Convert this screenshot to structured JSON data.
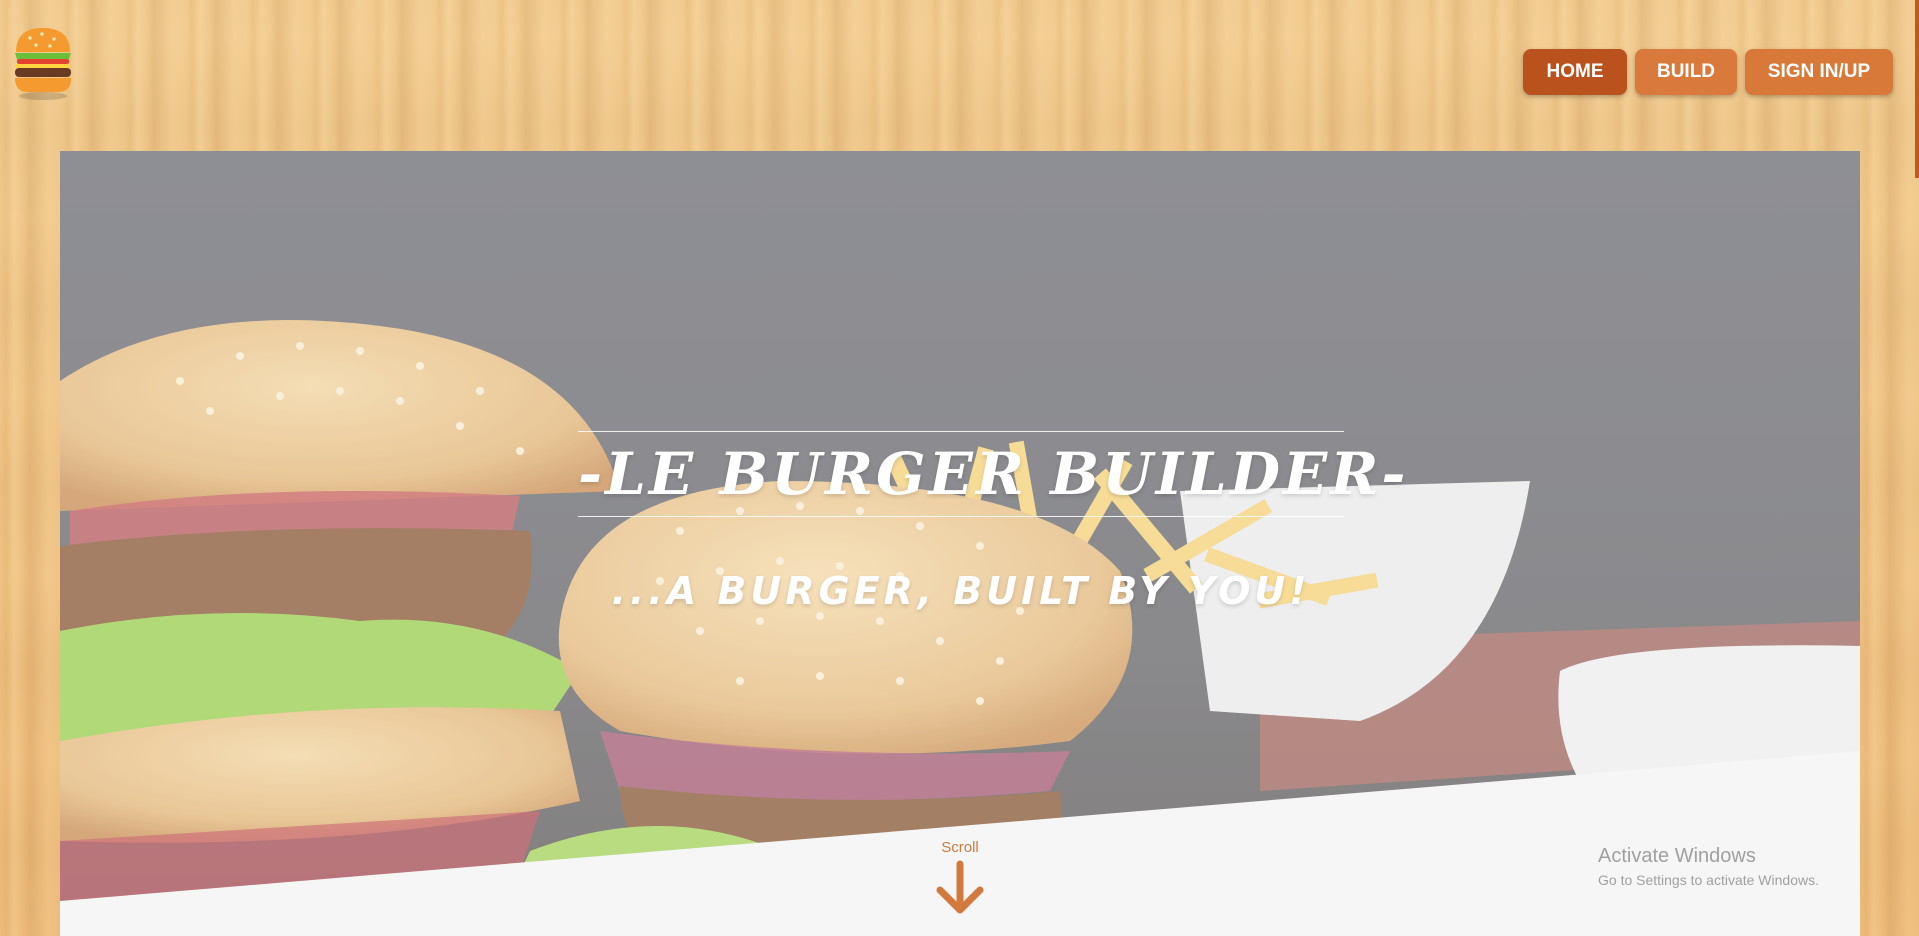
{
  "header": {
    "logo": "burger-logo-icon",
    "nav": [
      {
        "label": "HOME",
        "color": "#b9521c"
      },
      {
        "label": "BUILD",
        "color": "#d97a3c"
      },
      {
        "label": "SIGN IN/UP",
        "color": "#d8793a"
      }
    ]
  },
  "hero": {
    "image": "burgers-and-fries-photo",
    "title": "-LE BURGER BUILDER-",
    "subtitle": "...A BURGER, BUILT BY YOU!",
    "scroll_label": "Scroll",
    "scroll_icon": "arrow-down-icon"
  },
  "watermark": {
    "line1": "Activate Windows",
    "line2": "Go to Settings to activate Windows."
  },
  "colors": {
    "accent": "#b9521c",
    "accent_light": "#d97a3c",
    "wood": "#f0c588"
  }
}
